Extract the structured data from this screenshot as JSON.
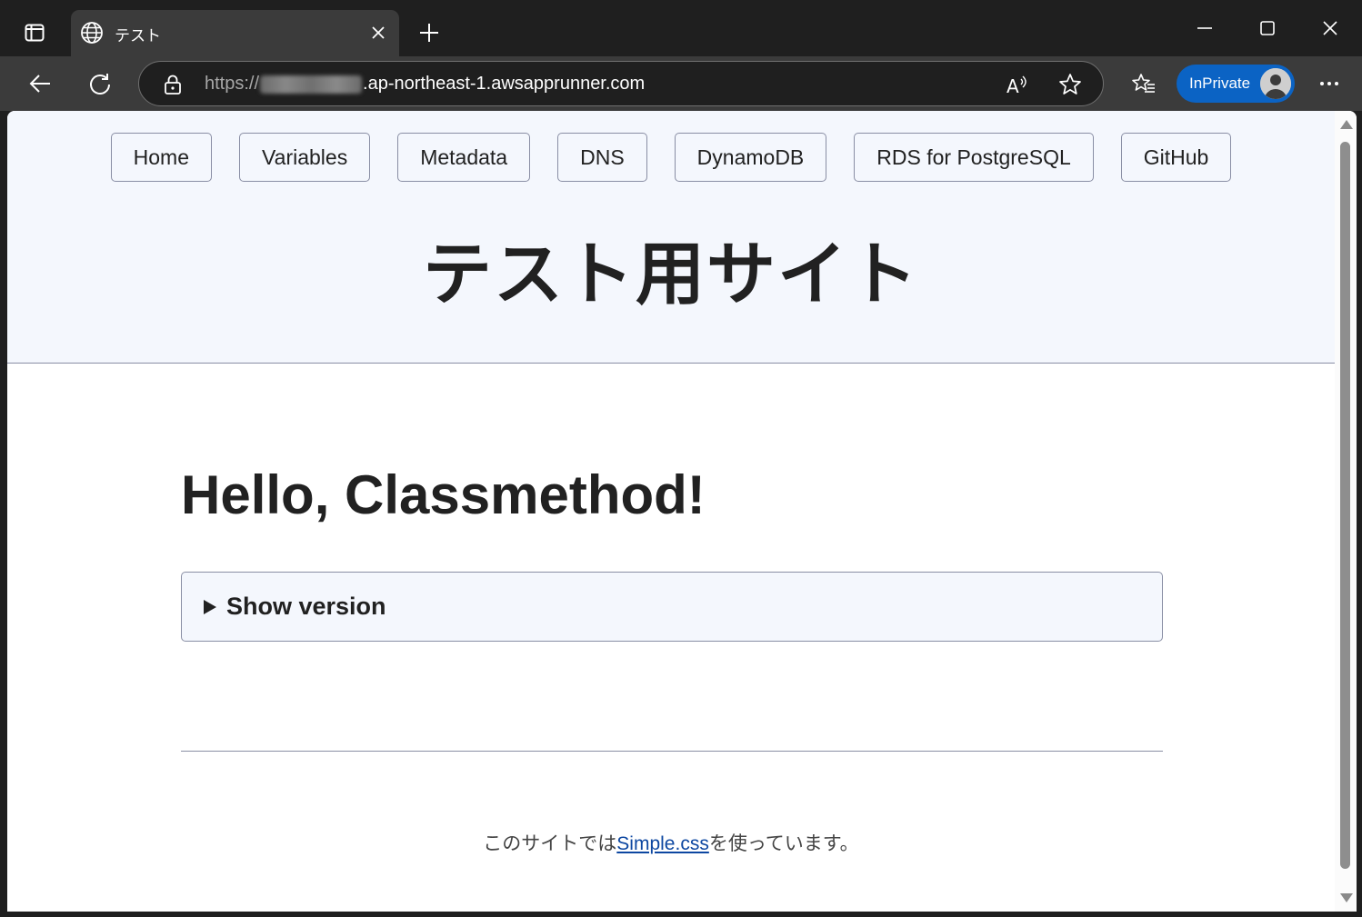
{
  "tab": {
    "title": "テスト"
  },
  "address": {
    "scheme": "https://",
    "host": ".ap-northeast-1.awsapprunner.com"
  },
  "profile": {
    "label": "InPrivate"
  },
  "nav": [
    "Home",
    "Variables",
    "Metadata",
    "DNS",
    "DynamoDB",
    "RDS for PostgreSQL",
    "GitHub"
  ],
  "header": {
    "title": "テスト用サイト"
  },
  "main": {
    "heading": "Hello, Classmethod!",
    "details_summary": "Show version"
  },
  "footer": {
    "prefix": "このサイトでは",
    "link": "Simple.css",
    "suffix": "を使っています。"
  },
  "colors": {
    "accent": "#0d47a1",
    "header_bg": "#f4f7fd",
    "border": "#898ea4",
    "inprivate": "#0b63c4"
  },
  "icons": {
    "tab_actions": "tab-actions-icon",
    "globe": "globe-icon",
    "close": "close-icon",
    "new_tab": "plus-icon",
    "back": "back-arrow-icon",
    "refresh": "refresh-icon",
    "lock": "lock-icon",
    "read_aloud": "read-aloud-icon",
    "favorite": "star-icon",
    "favorites": "favorites-icon",
    "more": "more-icon"
  }
}
